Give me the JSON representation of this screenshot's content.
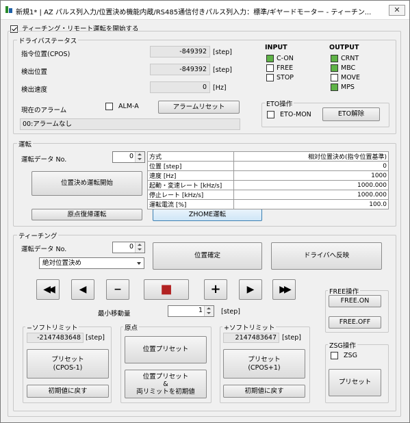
{
  "window": {
    "title": "新規1* | AZ パルス列入力/位置決め機能内蔵/RS485通信付きパルス列入力：標準/ギヤードモーター - ティーチン...",
    "close": "✕"
  },
  "teaching_remote": {
    "label": "ティーチング・リモート運転を開始する",
    "checked": true
  },
  "driver_status": {
    "title": "ドライバステータス",
    "rows": [
      {
        "label": "指令位置(CPOS)",
        "value": "-849392",
        "unit": "[step]"
      },
      {
        "label": "検出位置",
        "value": "-849392",
        "unit": "[step]"
      },
      {
        "label": "検出速度",
        "value": "0",
        "unit": "[Hz]"
      }
    ],
    "alarm_label": "現在のアラーム",
    "alma_label": "ALM-A",
    "alarm_reset": "アラームリセット",
    "alarm_text": "00:アラームなし",
    "input_title": "INPUT",
    "inputs": [
      {
        "label": "C-ON",
        "on": true
      },
      {
        "label": "FREE",
        "on": false
      },
      {
        "label": "STOP",
        "on": false
      }
    ],
    "output_title": "OUTPUT",
    "outputs": [
      {
        "label": "CRNT",
        "on": true
      },
      {
        "label": "MBC",
        "on": true
      },
      {
        "label": "MOVE",
        "on": false
      },
      {
        "label": "MPS",
        "on": true
      }
    ],
    "eto": {
      "title": "ETO操作",
      "mon_label": "ETO-MON",
      "release": "ETO解除"
    }
  },
  "operation": {
    "title": "運転",
    "data_no_label": "運転データ No.",
    "data_no": "0",
    "start_button": "位置決め運転開始",
    "home_button": "原点復帰運転",
    "zhome_button": "ZHOME運転",
    "table": [
      {
        "k": "方式",
        "v": "相対位置決め(指令位置基準)"
      },
      {
        "k": "位置 [step]",
        "v": "0"
      },
      {
        "k": "速度 [Hz]",
        "v": "1000"
      },
      {
        "k": "起動・変速レート [kHz/s]",
        "v": "1000.000"
      },
      {
        "k": "停止レート [kHz/s]",
        "v": "1000.000"
      },
      {
        "k": "運転電流 [%]",
        "v": "100.0"
      }
    ]
  },
  "teaching": {
    "title": "ティーチング",
    "data_no_label": "運転データ No.",
    "data_no": "0",
    "mode": "絶対位置決め",
    "confirm_button": "位置確定",
    "reflect_button": "ドライバへ反映",
    "jog": {
      "fast_rev": "◀◀",
      "rev": "◀",
      "minus": "−",
      "stop": "■",
      "plus": "+",
      "fwd": "▶",
      "fast_fwd": "▶▶"
    },
    "min_move_label": "最小移動量",
    "min_move": "1",
    "min_move_unit": "[step]"
  },
  "soft_limit_minus": {
    "title": "−ソフトリミット",
    "value": "-2147483648",
    "unit": "[step]",
    "preset": "プリセット\n(CPOS-1)",
    "reset": "初期値に戻す"
  },
  "origin": {
    "title": "原点",
    "preset": "位置プリセット",
    "preset_limit": "位置プリセット\n&\n両リミットを初期値"
  },
  "soft_limit_plus": {
    "title": "+ソフトリミット",
    "value": "2147483647",
    "unit": "[step]",
    "preset": "プリセット\n(CPOS+1)",
    "reset": "初期値に戻す"
  },
  "free_op": {
    "title": "FREE操作",
    "on": "FREE.ON",
    "off": "FREE.OFF"
  },
  "zsg_op": {
    "title": "ZSG操作",
    "label": "ZSG",
    "preset": "プリセット"
  },
  "colors": {
    "led_green": "#5fb347",
    "stop_red": "#b22222",
    "highlight_blue": "#cfe6f7"
  }
}
